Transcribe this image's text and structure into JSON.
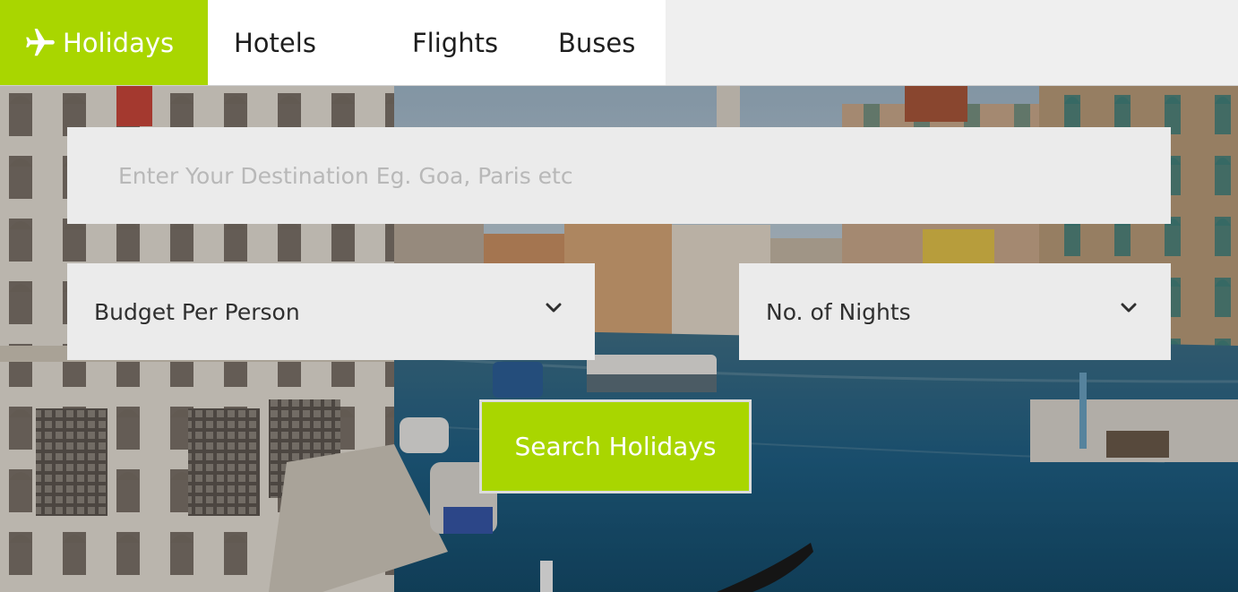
{
  "tabs": [
    {
      "label": "Holidays",
      "icon": "airplane-icon",
      "active": true
    },
    {
      "label": "Hotels",
      "active": false
    },
    {
      "label": "Flights",
      "active": false
    },
    {
      "label": "Buses",
      "active": false
    }
  ],
  "search": {
    "destination_placeholder": "Enter Your Destination Eg. Goa, Paris etc",
    "budget_label": "Budget Per Person",
    "nights_label": "No. of Nights",
    "button_label": "Search Holidays"
  },
  "colors": {
    "accent": "#a9d600",
    "field_bg": "#ebebeb",
    "placeholder": "#b8b8b8",
    "tabbar_bg": "#efefef"
  }
}
